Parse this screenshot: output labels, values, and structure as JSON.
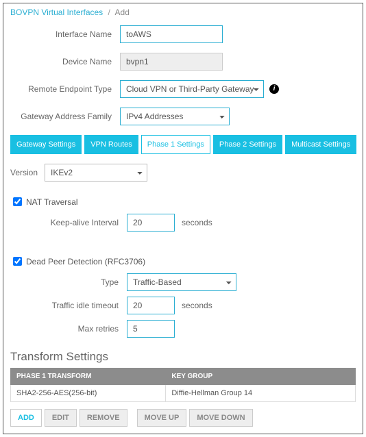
{
  "breadcrumb": {
    "root": "BOVPN Virtual Interfaces",
    "current": "Add"
  },
  "form": {
    "interface_name": {
      "label": "Interface Name",
      "value": "toAWS"
    },
    "device_name": {
      "label": "Device Name",
      "value": "bvpn1"
    },
    "remote_endpoint": {
      "label": "Remote Endpoint Type",
      "value": "Cloud VPN or Third-Party Gateway"
    },
    "gw_family": {
      "label": "Gateway Address Family",
      "value": "IPv4 Addresses"
    }
  },
  "tabs": {
    "gateway": "Gateway Settings",
    "routes": "VPN Routes",
    "phase1": "Phase 1 Settings",
    "phase2": "Phase 2 Settings",
    "multicast": "Multicast Settings"
  },
  "phase1": {
    "version": {
      "label": "Version",
      "value": "IKEv2"
    },
    "nat": {
      "label": "NAT Traversal",
      "checked": true,
      "keepalive_label": "Keep-alive Interval",
      "keepalive_value": "20",
      "keepalive_unit": "seconds"
    },
    "dpd": {
      "label": "Dead Peer Detection (RFC3706)",
      "checked": true,
      "type_label": "Type",
      "type_value": "Traffic-Based",
      "idle_label": "Traffic idle timeout",
      "idle_value": "20",
      "idle_unit": "seconds",
      "retry_label": "Max retries",
      "retry_value": "5"
    }
  },
  "transform": {
    "heading": "Transform Settings",
    "col1": "Phase 1 Transform",
    "col2": "Key Group",
    "row1_c1": "SHA2-256-AES(256-bit)",
    "row1_c2": "Diffie-Hellman Group 14"
  },
  "buttons": {
    "add": "ADD",
    "edit": "EDIT",
    "remove": "REMOVE",
    "moveup": "MOVE UP",
    "movedown": "MOVE DOWN"
  },
  "chart_data": null
}
